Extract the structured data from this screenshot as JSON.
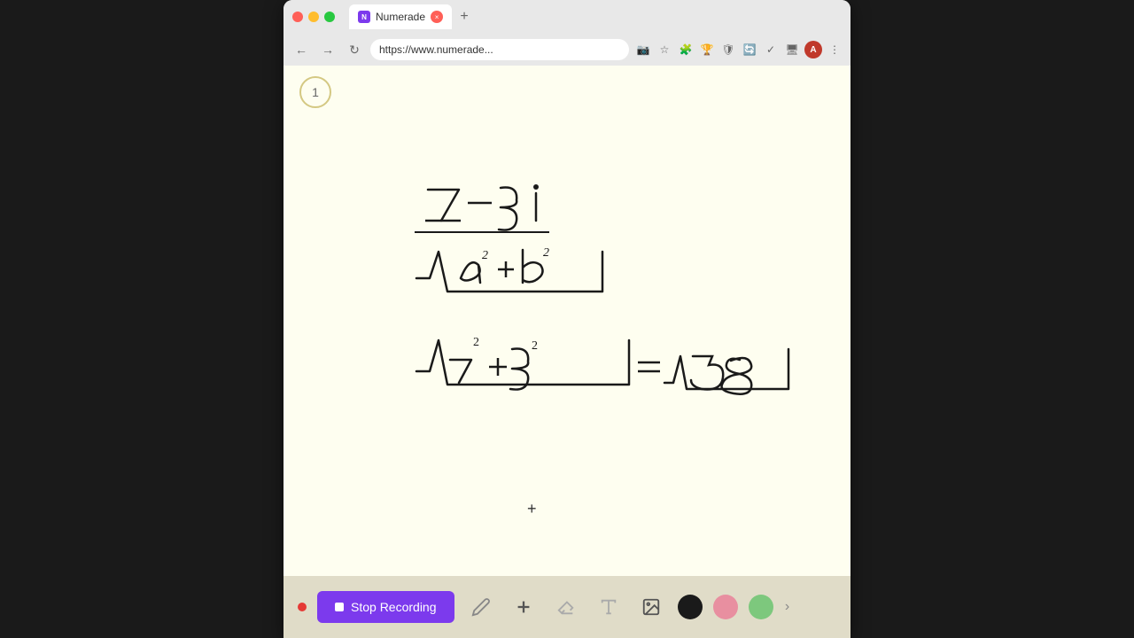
{
  "browser": {
    "tab_title": "Numerade",
    "tab_favicon_text": "N",
    "url": "https://www.numerade...",
    "new_tab_label": "+",
    "avatar_letter": "A"
  },
  "nav": {
    "back_icon": "←",
    "forward_icon": "→",
    "refresh_icon": "↻",
    "bookmark_icon": "☆",
    "more_icon": "⋮"
  },
  "step": {
    "number": "1"
  },
  "toolbar": {
    "stop_recording_label": "Stop Recording",
    "colors": [
      "#1a1a1a",
      "#e88fa0",
      "#7dc87d"
    ]
  },
  "math": {
    "formula_description": "7 - 3i over sqrt(a^2 + b^2) = sqrt(7^2 + 3^2) = sqrt(58)"
  }
}
